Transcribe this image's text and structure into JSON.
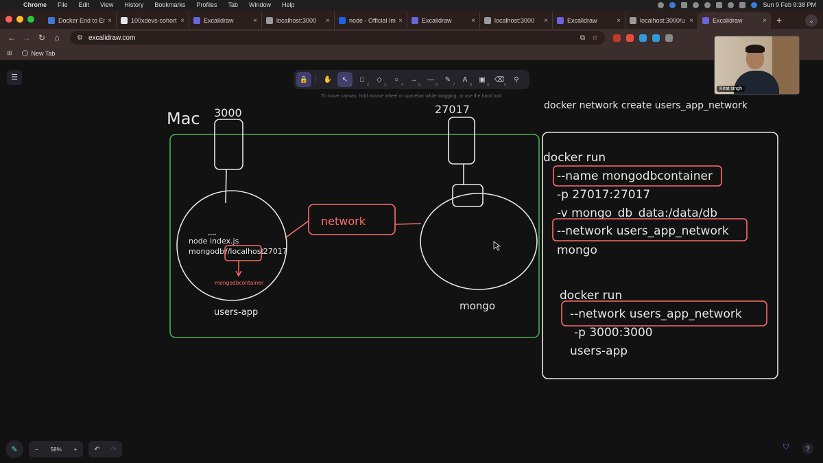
{
  "menubar": {
    "app": "Chrome",
    "items": [
      "File",
      "Edit",
      "View",
      "History",
      "Bookmarks",
      "Profiles",
      "Tab",
      "Window",
      "Help"
    ],
    "datetime": "Sun 9 Feb  9:38 PM"
  },
  "tabs": [
    {
      "title": "Docker End to End",
      "fav_color": "#3b7bd6"
    },
    {
      "title": "100xdevs-cohort",
      "fav_color": "#e6e6e6"
    },
    {
      "title": "Excalidraw",
      "fav_color": "#6965db"
    },
    {
      "title": "localhost:3000",
      "fav_color": "#9a9a9a"
    },
    {
      "title": "node - Official Im",
      "fav_color": "#1d63ed"
    },
    {
      "title": "Excalidraw",
      "fav_color": "#6965db"
    },
    {
      "title": "localhost:3000",
      "fav_color": "#9a9a9a"
    },
    {
      "title": "Excalidraw",
      "fav_color": "#6965db"
    },
    {
      "title": "localhost:3000/u",
      "fav_color": "#9a9a9a"
    },
    {
      "title": "Excalidraw",
      "fav_color": "#6965db",
      "active": true
    }
  ],
  "address": {
    "url": "excalidraw.com"
  },
  "bookmarks": [
    {
      "label": "New Tab"
    }
  ],
  "excalidraw": {
    "canvas_hint": "To move canvas, hold mouse wheel or spacebar while dragging, or use the hand tool",
    "tools": [
      {
        "name": "lock-tool",
        "glyph": "🔒",
        "key": ""
      },
      {
        "name": "hand-tool",
        "glyph": "✋",
        "key": ""
      },
      {
        "name": "selection-tool",
        "glyph": "↖",
        "key": "1"
      },
      {
        "name": "rectangle-tool",
        "glyph": "□",
        "key": "2"
      },
      {
        "name": "diamond-tool",
        "glyph": "◇",
        "key": "3"
      },
      {
        "name": "ellipse-tool",
        "glyph": "○",
        "key": "4"
      },
      {
        "name": "arrow-tool",
        "glyph": "→",
        "key": "5"
      },
      {
        "name": "line-tool",
        "glyph": "—",
        "key": "6"
      },
      {
        "name": "draw-tool",
        "glyph": "✎",
        "key": "7"
      },
      {
        "name": "text-tool",
        "glyph": "A",
        "key": "8"
      },
      {
        "name": "image-tool",
        "glyph": "▣",
        "key": "9"
      },
      {
        "name": "eraser-tool",
        "glyph": "⌫",
        "key": "0"
      },
      {
        "name": "extra-tools",
        "glyph": "⚲",
        "key": ""
      }
    ],
    "zoom": "58%"
  },
  "drawing": {
    "host_label": "Mac",
    "port_left": "3000",
    "port_right": "27017",
    "node_line1": "node index.js",
    "node_line2_prefix": "mongodb:",
    "node_line2_host": "//localhost",
    "node_line2_port": ":27017",
    "tiny_label": "pinned",
    "replacement": "mongodbcontainer",
    "network_label": "network",
    "users_app_label": "users-app",
    "mongo_label": "mongo",
    "network_create_cmd": "docker network create users_app_network",
    "cmd1": {
      "title": "docker run",
      "name_flag": "--name mongodbcontainer",
      "port_flag": "-p 27017:27017",
      "volume_flag": "-v mongo_db_data:/data/db",
      "network_flag": "--network users_app_network",
      "image": "mongo"
    },
    "cmd2": {
      "title": "docker run",
      "network_flag": "--network users_app_network",
      "port_flag": "-p 3000:3000",
      "image": "users-app"
    }
  },
  "webcam": {
    "name": "Kirat singh"
  },
  "colors": {
    "green_box": "#4caf50",
    "red_box": "#ff6b6b",
    "sketch_white": "#e6e6e6",
    "accent": "#6965db"
  }
}
